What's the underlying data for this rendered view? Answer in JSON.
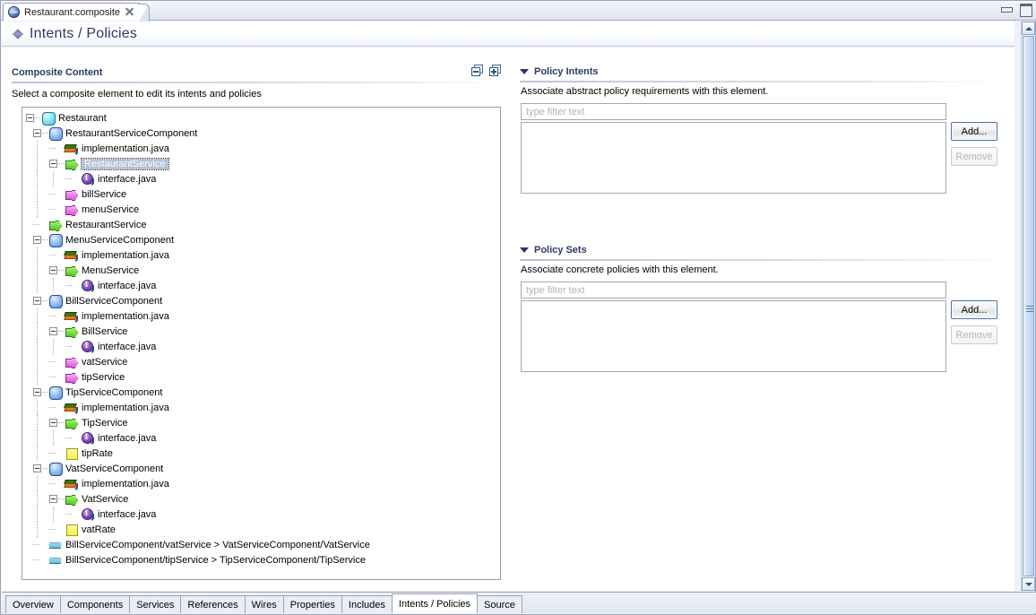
{
  "window": {
    "editor_tab_label": "Restaurant.composite",
    "editor_tab_icon": "composite-sphere-icon",
    "close_icon": "close-icon",
    "minimize_icon": "minimize-icon",
    "maximize_icon": "maximize-icon"
  },
  "form": {
    "title": "Intents / Policies",
    "title_icon": "intents-policies-diamond-icon"
  },
  "left": {
    "section_title": "Composite Content",
    "hint": "Select a composite element to edit its intents and policies",
    "collapse_all_icon": "collapse-all-icon",
    "expand_all_icon": "expand-all-icon",
    "tree": [
      {
        "label": "Restaurant",
        "icon": "composite-icon",
        "depth": 0,
        "twisty": "expanded",
        "selected": false
      },
      {
        "label": "RestaurantServiceComponent",
        "icon": "component-icon",
        "depth": 1,
        "twisty": "expanded",
        "selected": false
      },
      {
        "label": "implementation.java",
        "icon": "java-implementation-icon",
        "depth": 2,
        "twisty": "none",
        "selected": false
      },
      {
        "label": "RestaurantService",
        "icon": "service-icon",
        "depth": 2,
        "twisty": "expanded",
        "selected": true
      },
      {
        "label": "interface.java",
        "icon": "java-interface-icon",
        "depth": 3,
        "twisty": "none",
        "selected": false
      },
      {
        "label": "billService",
        "icon": "reference-icon",
        "depth": 2,
        "twisty": "none",
        "selected": false
      },
      {
        "label": "menuService",
        "icon": "reference-icon",
        "depth": 2,
        "twisty": "none",
        "selected": false
      },
      {
        "label": "RestaurantService",
        "icon": "service-icon",
        "depth": 1,
        "twisty": "none",
        "selected": false
      },
      {
        "label": "MenuServiceComponent",
        "icon": "component-icon",
        "depth": 1,
        "twisty": "expanded",
        "selected": false
      },
      {
        "label": "implementation.java",
        "icon": "java-implementation-icon",
        "depth": 2,
        "twisty": "none",
        "selected": false
      },
      {
        "label": "MenuService",
        "icon": "service-icon",
        "depth": 2,
        "twisty": "expanded",
        "selected": false
      },
      {
        "label": "interface.java",
        "icon": "java-interface-icon",
        "depth": 3,
        "twisty": "none",
        "selected": false
      },
      {
        "label": "BillServiceComponent",
        "icon": "component-icon",
        "depth": 1,
        "twisty": "expanded",
        "selected": false
      },
      {
        "label": "implementation.java",
        "icon": "java-implementation-icon",
        "depth": 2,
        "twisty": "none",
        "selected": false
      },
      {
        "label": "BillService",
        "icon": "service-icon",
        "depth": 2,
        "twisty": "expanded",
        "selected": false
      },
      {
        "label": "interface.java",
        "icon": "java-interface-icon",
        "depth": 3,
        "twisty": "none",
        "selected": false
      },
      {
        "label": "vatService",
        "icon": "reference-icon",
        "depth": 2,
        "twisty": "none",
        "selected": false
      },
      {
        "label": "tipService",
        "icon": "reference-icon",
        "depth": 2,
        "twisty": "none",
        "selected": false
      },
      {
        "label": "TipServiceComponent",
        "icon": "component-icon",
        "depth": 1,
        "twisty": "expanded",
        "selected": false
      },
      {
        "label": "implementation.java",
        "icon": "java-implementation-icon",
        "depth": 2,
        "twisty": "none",
        "selected": false
      },
      {
        "label": "TipService",
        "icon": "service-icon",
        "depth": 2,
        "twisty": "expanded",
        "selected": false
      },
      {
        "label": "interface.java",
        "icon": "java-interface-icon",
        "depth": 3,
        "twisty": "none",
        "selected": false
      },
      {
        "label": "tipRate",
        "icon": "property-icon",
        "depth": 2,
        "twisty": "none",
        "selected": false
      },
      {
        "label": "VatServiceComponent",
        "icon": "component-icon",
        "depth": 1,
        "twisty": "expanded",
        "selected": false
      },
      {
        "label": "implementation.java",
        "icon": "java-implementation-icon",
        "depth": 2,
        "twisty": "none",
        "selected": false
      },
      {
        "label": "VatService",
        "icon": "service-icon",
        "depth": 2,
        "twisty": "expanded",
        "selected": false
      },
      {
        "label": "interface.java",
        "icon": "java-interface-icon",
        "depth": 3,
        "twisty": "none",
        "selected": false
      },
      {
        "label": "vatRate",
        "icon": "property-icon",
        "depth": 2,
        "twisty": "none",
        "selected": false
      },
      {
        "label": "BillServiceComponent/vatService > VatServiceComponent/VatService",
        "icon": "wire-icon",
        "depth": 1,
        "twisty": "none",
        "selected": false
      },
      {
        "label": "BillServiceComponent/tipService > TipServiceComponent/TipService",
        "icon": "wire-icon",
        "depth": 1,
        "twisty": "none",
        "selected": false
      }
    ]
  },
  "policy_intents": {
    "title": "Policy Intents",
    "description": "Associate abstract policy requirements with this element.",
    "filter_placeholder": "type filter text",
    "filter_value": "",
    "items": [],
    "add_label": "Add...",
    "remove_label": "Remove",
    "remove_enabled": false,
    "collapse_icon": "caret-down-icon"
  },
  "policy_sets": {
    "title": "Policy Sets",
    "description": "Associate concrete policies with this element.",
    "filter_placeholder": "type filter text",
    "filter_value": "",
    "items": [],
    "add_label": "Add...",
    "remove_label": "Remove",
    "remove_enabled": false,
    "collapse_icon": "caret-down-icon"
  },
  "page_tabs": [
    {
      "label": "Overview",
      "active": false
    },
    {
      "label": "Components",
      "active": false
    },
    {
      "label": "Services",
      "active": false
    },
    {
      "label": "References",
      "active": false
    },
    {
      "label": "Wires",
      "active": false
    },
    {
      "label": "Properties",
      "active": false
    },
    {
      "label": "Includes",
      "active": false
    },
    {
      "label": "Intents / Policies",
      "active": true
    },
    {
      "label": "Source",
      "active": false
    }
  ],
  "colors": {
    "header_text": "#2b3a63",
    "selection": "#b6c2d6",
    "service_green": "#5bc62b",
    "reference_magenta": "#d95ad9",
    "composite_cyan": "#37c6e8",
    "component_blue": "#4f8fe0",
    "property_yellow": "#f5f54a",
    "interface_purple": "#8448c0",
    "wire_blue": "#5fb8d6"
  }
}
